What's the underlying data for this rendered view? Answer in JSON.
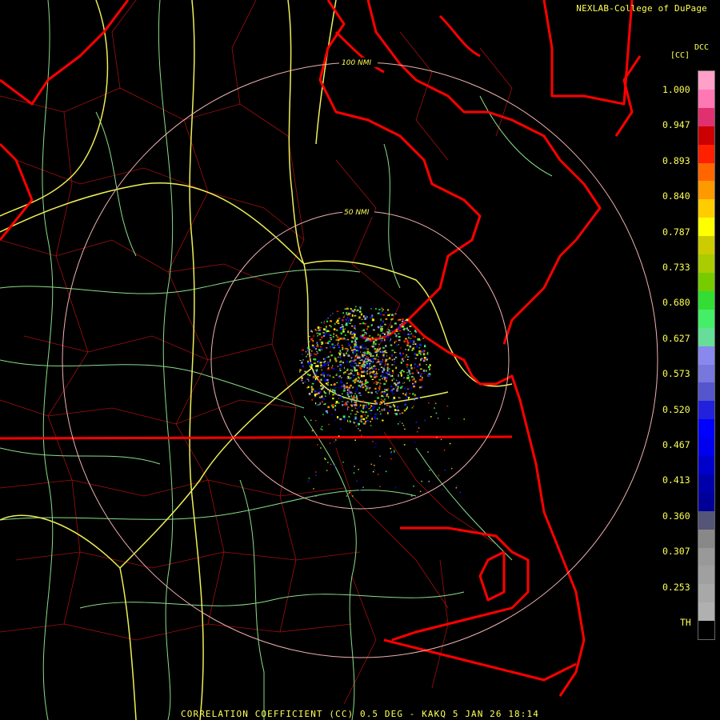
{
  "credit": "NEXLAB-College of DuPage",
  "footer": "CORRELATION COEFFICIENT (CC) 0.5 DEG - KAKQ 5 JAN 26 18:14",
  "colorbar": {
    "product": "DCC",
    "unit": "[CC]",
    "labels": [
      "1.000",
      "0.947",
      "0.893",
      "0.840",
      "0.787",
      "0.733",
      "0.680",
      "0.627",
      "0.573",
      "0.520",
      "0.467",
      "0.413",
      "0.360",
      "0.307",
      "0.253",
      "TH"
    ],
    "colors": [
      "#ffa0c8",
      "#ff78b4",
      "#e03070",
      "#cc0000",
      "#ff2000",
      "#ff6600",
      "#ff9900",
      "#ffcc00",
      "#ffff00",
      "#cccc00",
      "#aacc00",
      "#77cc00",
      "#33dd33",
      "#44ee66",
      "#66dd99",
      "#8888ee",
      "#7777dd",
      "#5555cc",
      "#2222dd",
      "#0000ff",
      "#0000ee",
      "#0000cc",
      "#0000aa",
      "#000099",
      "#555577",
      "#888888",
      "#999999",
      "#a0a0a0",
      "#a8a8a8",
      "#b0b0b0",
      "#000000"
    ]
  },
  "rings": [
    {
      "label": "50 NMI"
    },
    {
      "label": "100 NMI"
    }
  ],
  "colors": {
    "state_border": "#ff0000",
    "county_border": "#b01010",
    "road_major": "#ffff66",
    "road_minor": "#88dd88",
    "range_ring": "#f0b0b0",
    "text": "#ffff55"
  }
}
